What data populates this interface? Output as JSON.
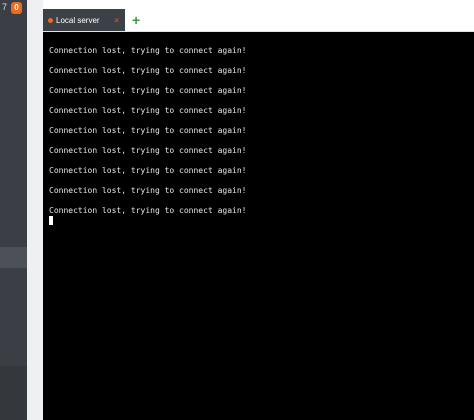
{
  "sidebar": {
    "counter_text": "7",
    "badge_count": "0",
    "badge_color": "#e96d1f"
  },
  "tabs": [
    {
      "label": "Local server",
      "status_color": "#ee6a22",
      "close_symbol": "×",
      "active": true
    }
  ],
  "add_tab_symbol": "+",
  "console": {
    "lines": [
      "Connection lost, trying to connect again!",
      "Connection lost, trying to connect again!",
      "Connection lost, trying to connect again!",
      "Connection lost, trying to connect again!",
      "Connection lost, trying to connect again!",
      "Connection lost, trying to connect again!",
      "Connection lost, trying to connect again!",
      "Connection lost, trying to connect again!",
      "Connection lost, trying to connect again!"
    ]
  }
}
